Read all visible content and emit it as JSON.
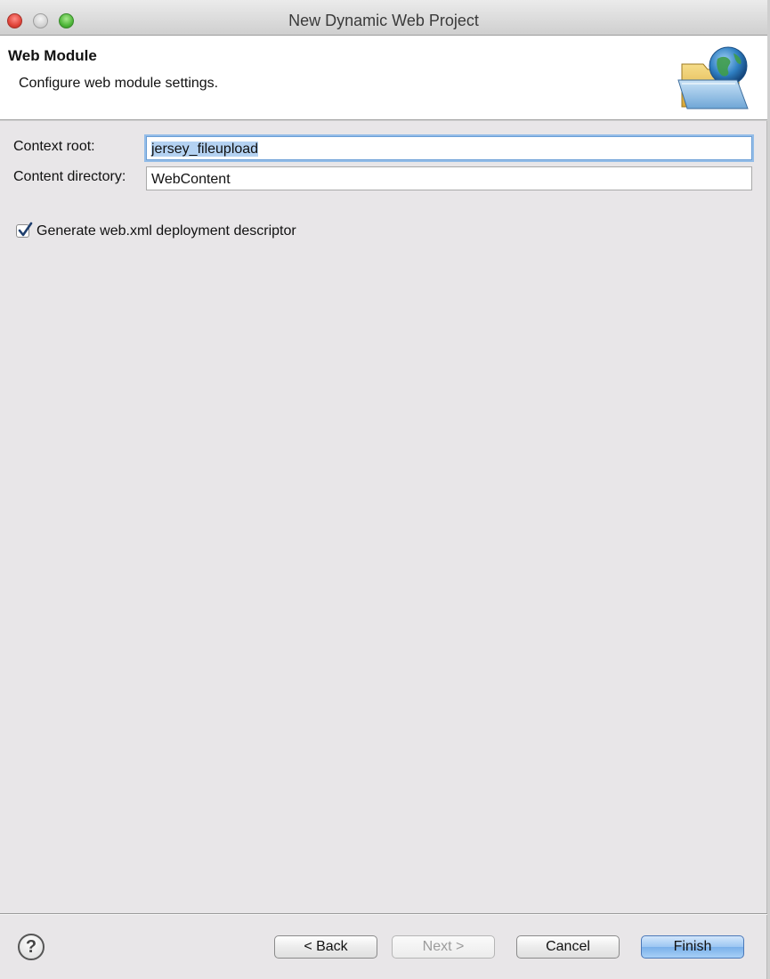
{
  "window": {
    "title": "New Dynamic Web Project"
  },
  "header": {
    "title": "Web Module",
    "description": "Configure web module settings.",
    "icon": "folder-globe-icon"
  },
  "form": {
    "context_root_label": "Context root:",
    "context_root_value": "jersey_fileupload",
    "content_dir_label": "Content directory:",
    "content_dir_value": "WebContent",
    "generate_webxml_label": "Generate web.xml deployment descriptor",
    "generate_webxml_checked": true
  },
  "footer": {
    "help_symbol": "?",
    "back_label": "< Back",
    "next_label": "Next >",
    "cancel_label": "Cancel",
    "finish_label": "Finish"
  },
  "colors": {
    "focus": "#94bde8",
    "default_button": "#7ab0ea"
  }
}
